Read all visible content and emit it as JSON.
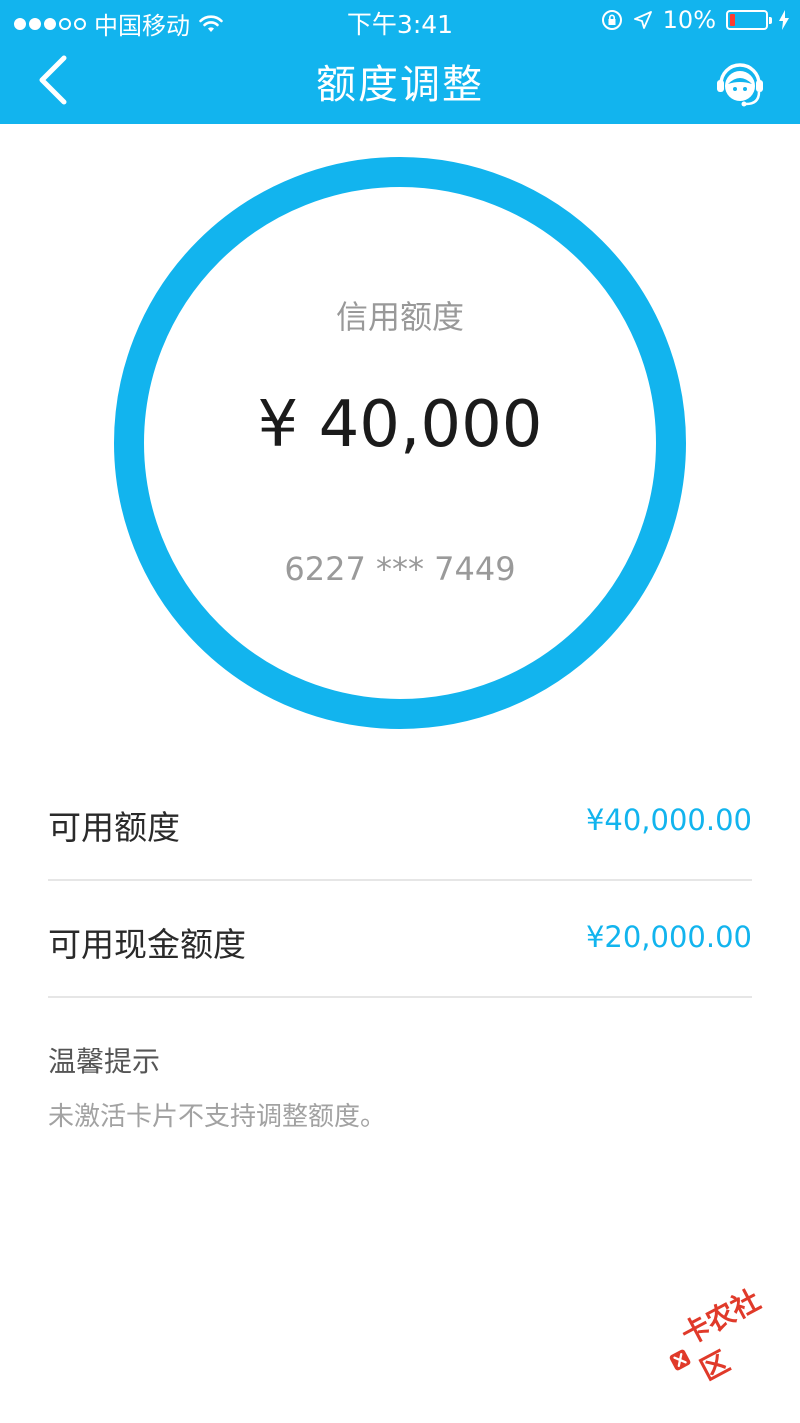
{
  "status_bar": {
    "carrier": "中国移动",
    "time": "下午3:41",
    "battery": "10%"
  },
  "nav": {
    "title": "额度调整"
  },
  "credit": {
    "label": "信用额度",
    "amount": "¥ 40,000",
    "card_number": "6227 *** 7449"
  },
  "rows": [
    {
      "label": "可用额度",
      "value": "¥40,000.00"
    },
    {
      "label": "可用现金额度",
      "value": "¥20,000.00"
    }
  ],
  "tips": {
    "title": "温馨提示",
    "text": "未激活卡片不支持调整额度。"
  },
  "watermark": {
    "text": "卡农社区"
  },
  "colors": {
    "accent": "#12b4ee",
    "battery_low": "#ff3b30",
    "watermark": "#e03a2a"
  }
}
